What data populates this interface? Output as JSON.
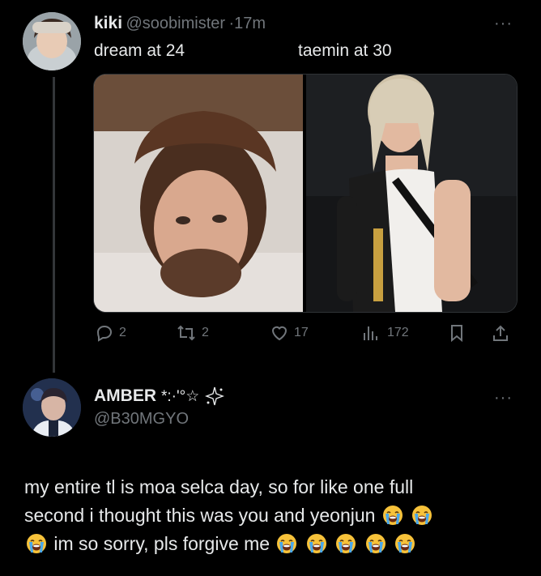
{
  "tweet": {
    "display_name": "kiki",
    "handle": "@soobimister",
    "separator": "·",
    "time": "17m",
    "caption_left": "dream at 24",
    "caption_right": "taemin at 30",
    "more": "···",
    "stats": {
      "replies": "2",
      "retweets": "2",
      "likes": "17",
      "views": "172"
    },
    "icons": [
      "reply-icon",
      "retweet-icon",
      "like-icon",
      "views-icon",
      "bookmark-icon",
      "share-icon"
    ]
  },
  "reply": {
    "display_name": "AMBER",
    "name_deco": "*:·'°☆",
    "handle": "@B30MGYO",
    "more": "···",
    "text_line1": "my entire tl is moa selca day, so for like one full",
    "text_line2": "second i thought this was you and yeonjun",
    "text_line3": "im so sorry, pls forgive me",
    "emoji_name": "loudly-crying-face-emoji"
  },
  "colors": {
    "background": "#000000",
    "text": "#e7e9ea",
    "muted": "#71767b",
    "divider": "#333639"
  }
}
